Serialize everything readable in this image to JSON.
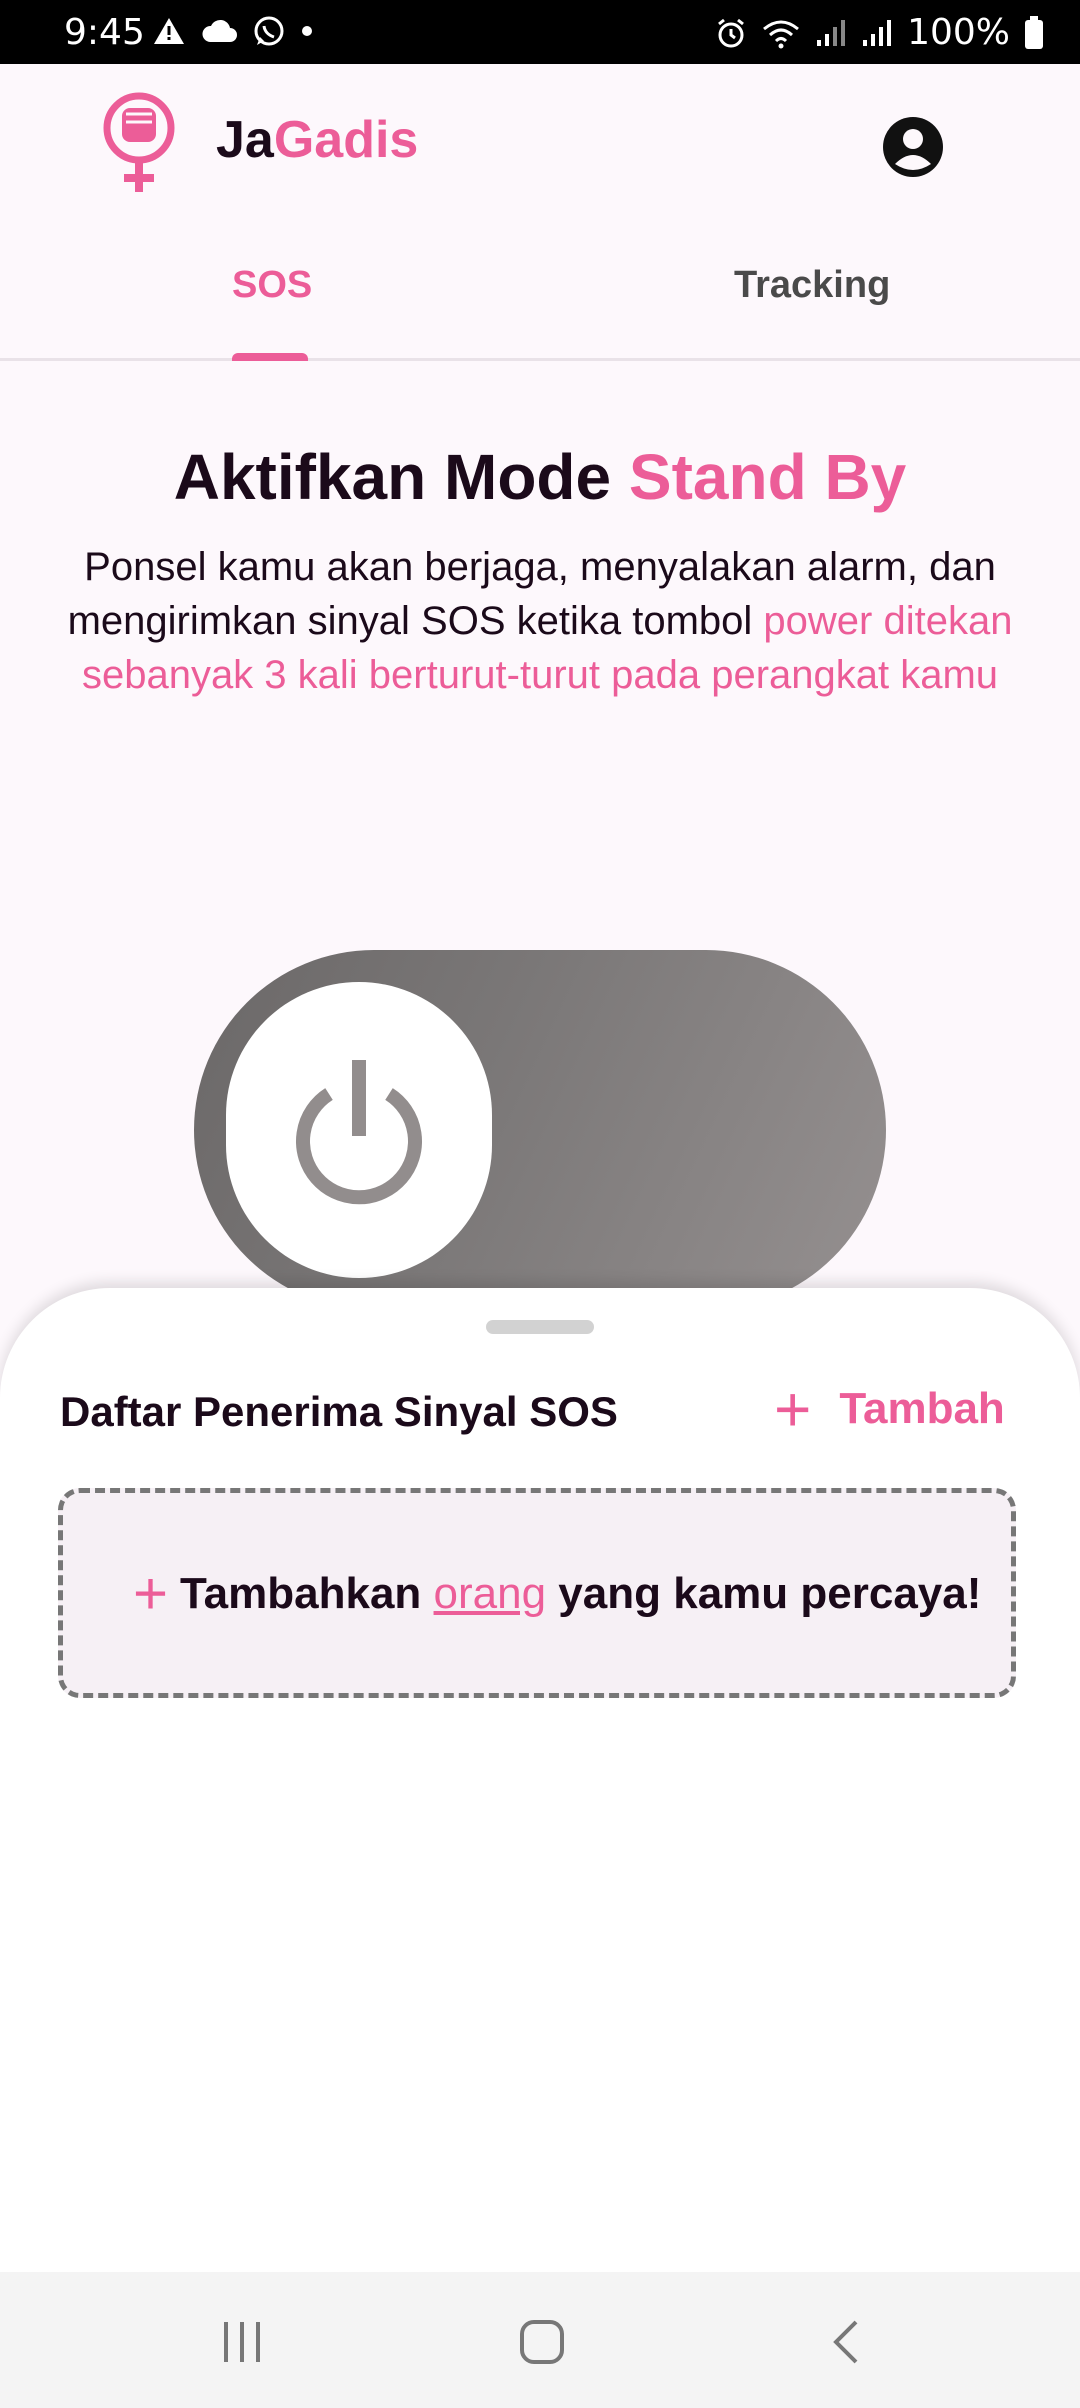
{
  "status_bar": {
    "time": "9:45",
    "battery": "100%",
    "left_icons": [
      "warning-icon",
      "cloud-icon",
      "whatsapp-icon",
      "dot-icon"
    ],
    "right_icons": [
      "alarm-icon",
      "wifi-icon",
      "signal-icon",
      "signal-icon",
      "battery-icon"
    ]
  },
  "header": {
    "app_name_part1": "Ja",
    "app_name_part2": "Gadis",
    "logo_icon": "feminist-fist-icon",
    "account_icon": "account-circle-icon"
  },
  "tabs": [
    {
      "label": "SOS",
      "active": true
    },
    {
      "label": "Tracking",
      "active": false
    }
  ],
  "main": {
    "title_part1": "Aktifkan Mode ",
    "title_part2": "Stand By",
    "desc_part1": "Ponsel kamu akan berjaga, menyalakan alarm, dan mengirimkan sinyal SOS ketika tombol ",
    "desc_part2": "power ditekan sebanyak 3 kali berturut-turut pada perangkat kamu",
    "toggle_state": "off",
    "toggle_icon": "power-icon"
  },
  "sheet": {
    "title": "Daftar Penerima Sinyal SOS",
    "add_label": "Tambah",
    "empty_prefix": "Tambahkan ",
    "empty_link": "orang",
    "empty_suffix": " yang kamu percaya!"
  },
  "navbar": {
    "recents_icon": "recents-icon",
    "home_icon": "home-icon",
    "back_icon": "back-icon"
  },
  "colors": {
    "accent": "#ec5d98",
    "text": "#1b0a1a",
    "background": "#fdf8fc"
  }
}
